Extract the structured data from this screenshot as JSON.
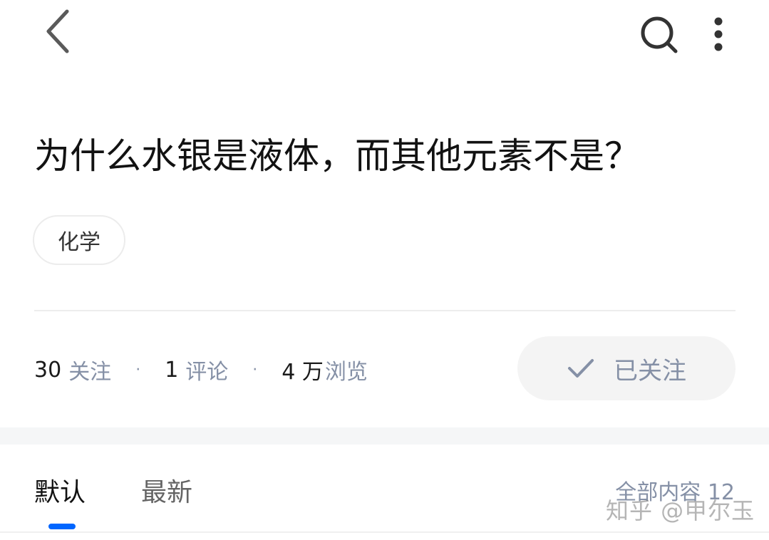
{
  "question": {
    "title": "为什么水银是液体，而其他元素不是？",
    "tags": [
      "化学"
    ]
  },
  "stats": {
    "followers_count": "30",
    "followers_label": "关注",
    "comments_count": "1",
    "comments_label": "评论",
    "views_count": "4 万",
    "views_label": "浏览",
    "separator": "·"
  },
  "follow_button": {
    "label": "已关注"
  },
  "tabs": [
    {
      "label": "默认",
      "active": true
    },
    {
      "label": "最新",
      "active": false
    }
  ],
  "content_count": "全部内容 12",
  "watermark": "知乎 @甲尔玉",
  "icons": {
    "back": "back-arrow-icon",
    "search": "search-icon",
    "more": "more-vertical-icon",
    "check": "check-icon"
  },
  "colors": {
    "accent": "#0066ff",
    "muted_text": "#8590a6",
    "button_bg": "#f4f4f4"
  }
}
